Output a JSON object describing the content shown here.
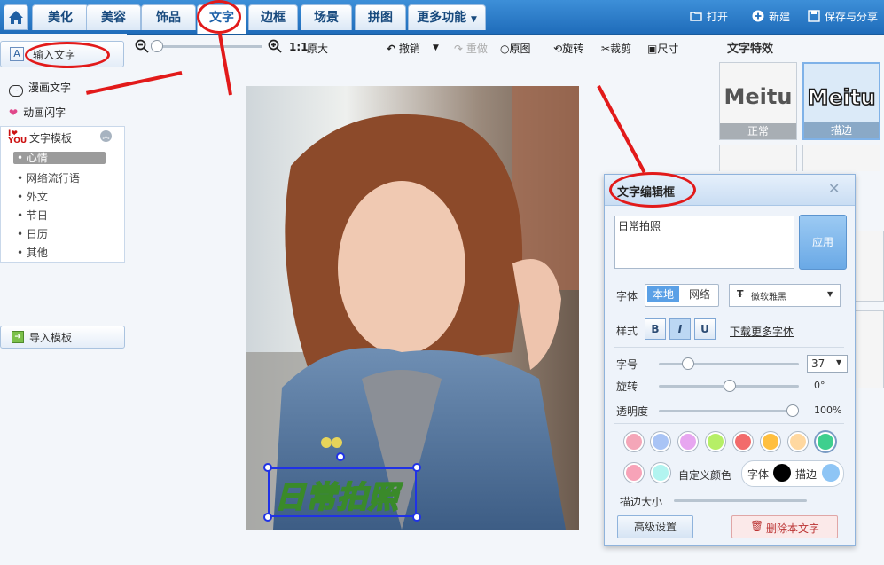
{
  "nav": {
    "tabs": [
      "美化",
      "美容",
      "饰品",
      "文字",
      "边框",
      "场景",
      "拼图",
      "更多功能"
    ],
    "active_tab": "文字",
    "open": "打开",
    "new": "新建",
    "save_share": "保存与分享"
  },
  "toolbar": {
    "zoom_ratio": "1:1",
    "original_size": "原大",
    "undo": "撤销",
    "redo": "重做",
    "original": "原图",
    "rotate": "旋转",
    "crop": "裁剪",
    "size": "尺寸",
    "zoom_level": 0.0
  },
  "left": {
    "input_text": "输入文字",
    "comic_text": "漫画文字",
    "animated_text": "动画闪字",
    "template_title": "文字模板",
    "template_items": [
      "心情",
      "网络流行语",
      "外文",
      "节日",
      "日历",
      "其他"
    ],
    "selected_template": "心情",
    "import_template": "导入模板"
  },
  "canvas": {
    "overlay_text": "日常拍照"
  },
  "effects": {
    "title": "文字特效",
    "items": [
      {
        "word": "Meitu",
        "caption": "正常"
      },
      {
        "word": "Meitu",
        "caption": "描边"
      }
    ]
  },
  "editor": {
    "title": "文字编辑框",
    "text_value": "日常拍照",
    "apply": "应用",
    "font_label": "字体",
    "font_local": "本地",
    "font_network": "网络",
    "font_name": "微软雅黑",
    "style_label": "样式",
    "style_bold": "B",
    "style_italic": "I",
    "style_underline": "U",
    "download_fonts": "下载更多字体",
    "size_label": "字号",
    "size_value": "37",
    "size_level": 0.2,
    "rotate_label": "旋转",
    "rotate_value": "0°",
    "rotate_level": 0.5,
    "opacity_label": "透明度",
    "opacity_value": "100%",
    "opacity_level": 1.0,
    "custom_color": "自定义颜色",
    "font_color_label": "字体",
    "stroke_label": "描边",
    "stroke_size_label": "描边大小",
    "advanced": "高级设置",
    "delete_text": "删除本文字",
    "colors": [
      "#f4a6b8",
      "#a9c4f5",
      "#e7a6f0",
      "#b6ef67",
      "#f26b6b",
      "#ffbf3f",
      "#ffd8a0",
      "#3fcf8e",
      "#f7a3b8",
      "#b2f4f0"
    ],
    "font_color": "#000000",
    "stroke_color": "#8ec5f5"
  }
}
